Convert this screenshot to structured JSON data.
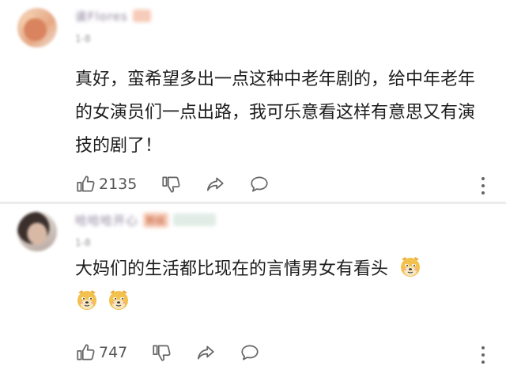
{
  "comments": [
    {
      "username": "诶Flores",
      "badge": "",
      "meta": "1-8",
      "content": "真好，蛮希望多出一点这种中老年剧的，给中年老年的女演员们一点出路，我可乐意看这样有意思又有演技的剧了！",
      "emojis": [],
      "likes": "2135"
    },
    {
      "username": "哈哈哈开心",
      "badge": "粉丝",
      "meta": "1-8",
      "content": "大妈们的生活都比现在的言情男女有看头",
      "emojis": [
        "doge-emoji",
        "doge-emoji",
        "doge-emoji"
      ],
      "likes": "747"
    }
  ],
  "icons": {
    "like": "thumbs-up-icon",
    "dislike": "thumbs-down-icon",
    "share": "share-arrow-icon",
    "reply": "comment-bubble-icon",
    "more": "more-vertical-icon"
  },
  "colors": {
    "text": "#1d1d1d",
    "muted": "#666666",
    "divider": "#ececec",
    "emoji": "#f2c14e"
  }
}
